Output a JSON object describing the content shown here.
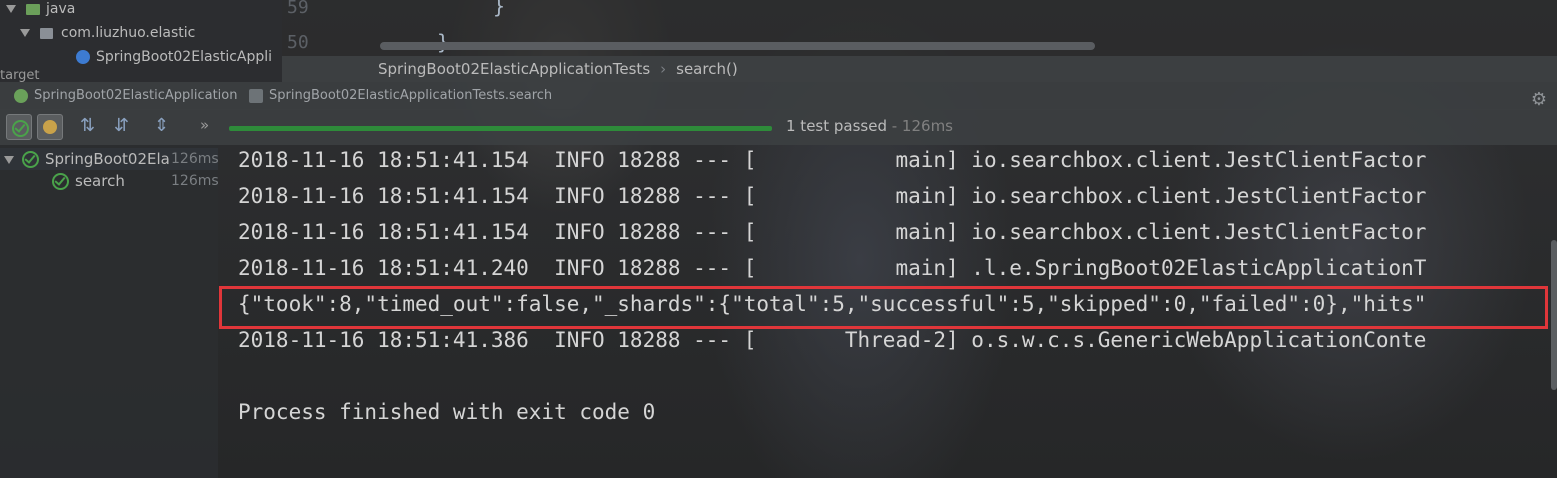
{
  "project_tree": {
    "folder_java": "java",
    "package": "com.liuzhuo.elastic",
    "class_file": "SpringBoot02ElasticAppli",
    "target_partial": "target"
  },
  "editor": {
    "line_numbers": [
      "59",
      "50"
    ],
    "line1_code": "}",
    "line2_code": "}",
    "breadcrumb_class": "SpringBoot02ElasticApplicationTests",
    "breadcrumb_method": "search()"
  },
  "run_tabs": [
    {
      "label": "SpringBoot02ElasticApplication"
    },
    {
      "label": "SpringBoot02ElasticApplicationTests.search"
    }
  ],
  "toolbar": {
    "more": "»",
    "status_main": "1 test passed",
    "status_time": " - 126ms",
    "progress_percent": 100
  },
  "test_tree": {
    "root_label": "SpringBoot02Ela",
    "root_time": "126ms",
    "child_label": "search",
    "child_time": "126ms"
  },
  "console": {
    "lines": [
      "2018-11-16 18:51:41.154  INFO 18288 --- [           main] io.searchbox.client.JestClientFactor",
      "2018-11-16 18:51:41.154  INFO 18288 --- [           main] io.searchbox.client.JestClientFactor",
      "2018-11-16 18:51:41.154  INFO 18288 --- [           main] io.searchbox.client.JestClientFactor",
      "2018-11-16 18:51:41.240  INFO 18288 --- [           main] .l.e.SpringBoot02ElasticApplicationT",
      "{\"took\":8,\"timed_out\":false,\"_shards\":{\"total\":5,\"successful\":5,\"skipped\":0,\"failed\":0},\"hits\"",
      "2018-11-16 18:51:41.386  INFO 18288 --- [       Thread-2] o.s.w.c.s.GenericWebApplicationConte",
      "",
      "Process finished with exit code 0"
    ]
  },
  "colors": {
    "highlight_border": "#e0363a",
    "progress": "#2e8b3a",
    "pass_green": "#4aa24a"
  }
}
